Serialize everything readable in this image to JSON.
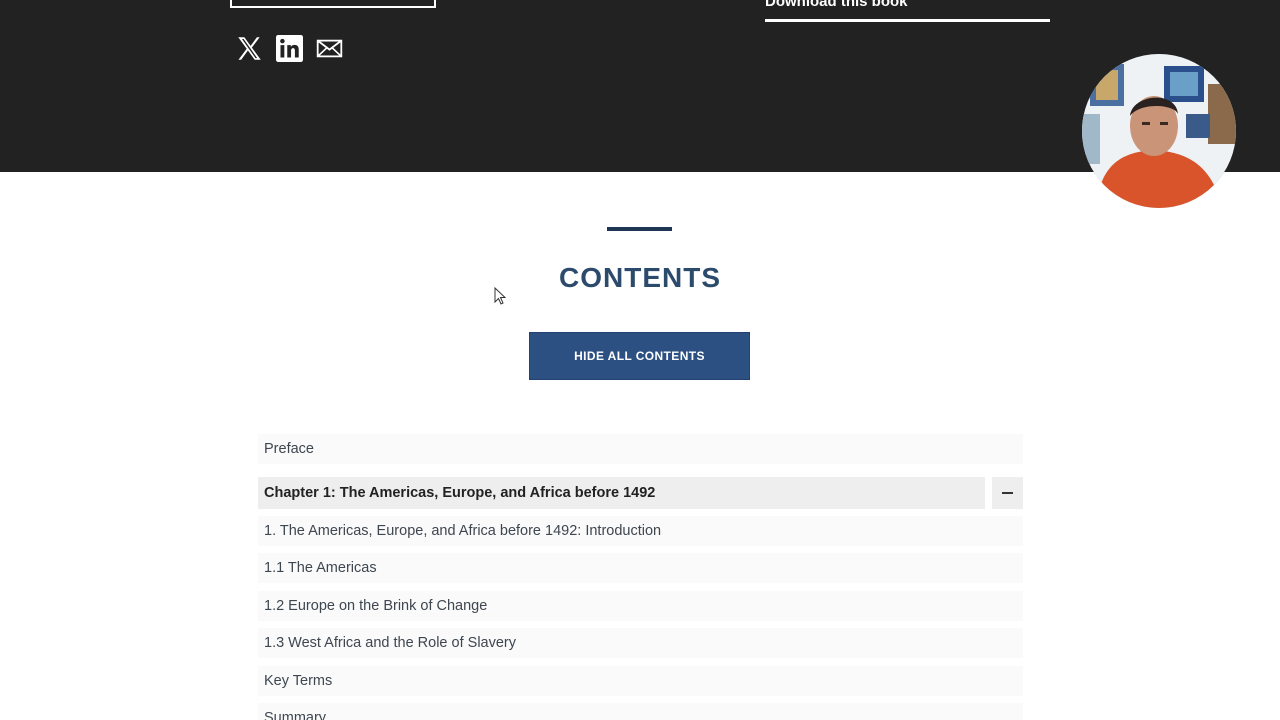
{
  "header": {
    "download_label": "Download this book",
    "social_icons": [
      "x-logo-icon",
      "linkedin-icon",
      "email-icon"
    ]
  },
  "contents": {
    "title": "CONTENTS",
    "hide_button_label": "HIDE ALL CONTENTS",
    "preface": "Preface",
    "chapter": {
      "title": "Chapter 1: The Americas, Europe, and Africa before 1492",
      "toggle_icon": "minus-icon",
      "items": [
        "1. The Americas, Europe, and Africa before 1492: Introduction",
        "1.1 The Americas",
        "1.2 Europe on the Brink of Change",
        "1.3 West Africa and the Role of Slavery",
        "Key Terms",
        "Summary"
      ]
    }
  },
  "colors": {
    "header_bg": "#222222",
    "accent": "#2d5082",
    "title": "#2c4a6b"
  }
}
